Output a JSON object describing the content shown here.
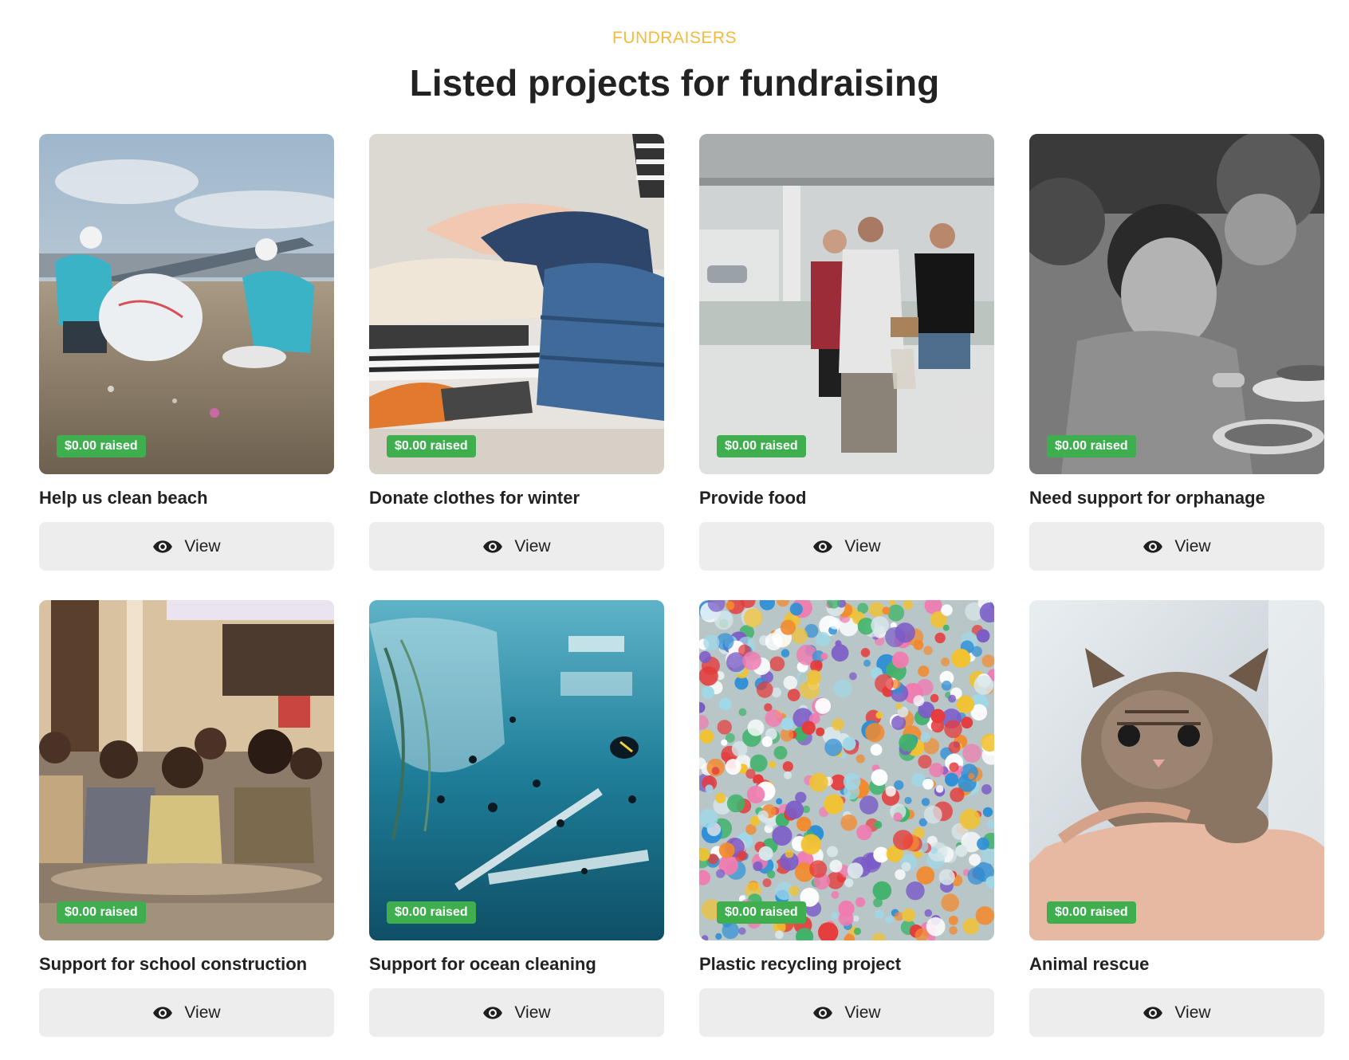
{
  "section": {
    "eyebrow": "FUNDRAISERS",
    "title": "Listed projects for fundraising"
  },
  "projects": [
    {
      "title": "Help us clean beach",
      "raised": "$0.00 raised",
      "view_label": "View",
      "image": "beach-cleanup-photo"
    },
    {
      "title": "Donate clothes for winter",
      "raised": "$0.00 raised",
      "view_label": "View",
      "image": "folded-clothes-photo"
    },
    {
      "title": "Provide food",
      "raised": "$0.00 raised",
      "view_label": "View",
      "image": "food-distribution-photo"
    },
    {
      "title": "Need support for orphanage",
      "raised": "$0.00 raised",
      "view_label": "View",
      "image": "orphanage-children-photo"
    },
    {
      "title": "Support for school construction",
      "raised": "$0.00 raised",
      "view_label": "View",
      "image": "school-children-photo"
    },
    {
      "title": "Support for ocean cleaning",
      "raised": "$0.00 raised",
      "view_label": "View",
      "image": "ocean-plastic-photo"
    },
    {
      "title": "Plastic recycling project",
      "raised": "$0.00 raised",
      "view_label": "View",
      "image": "plastic-caps-photo"
    },
    {
      "title": "Animal rescue",
      "raised": "$0.00 raised",
      "view_label": "View",
      "image": "kitten-in-hand-photo"
    }
  ],
  "icons": {
    "view": "eye-icon"
  },
  "colors": {
    "eyebrow": "#f5b93c",
    "badge": "#3fae4f",
    "button_bg": "#ededed",
    "heading": "#222222"
  }
}
